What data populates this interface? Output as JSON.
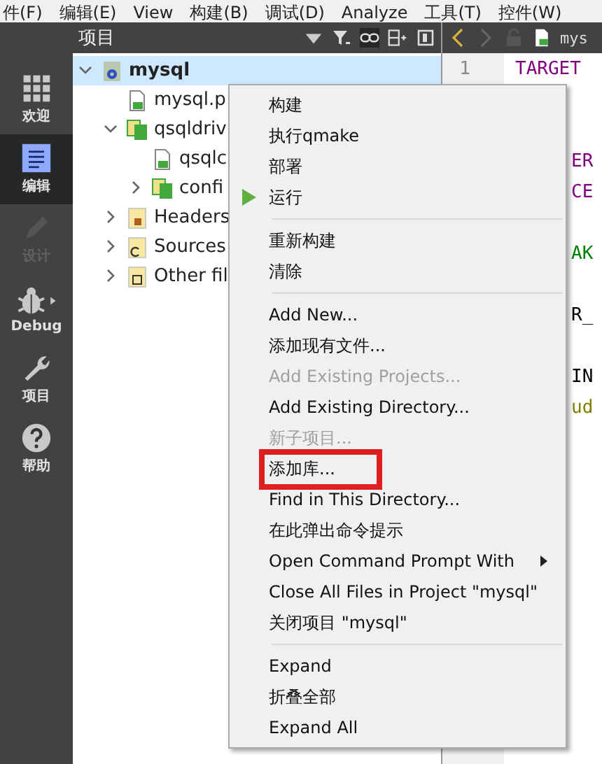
{
  "menu_bar": [
    "件(F)",
    "编辑(E)",
    "View",
    "构建(B)",
    "调试(D)",
    "Analyze",
    "工具(T)",
    "控件(W)"
  ],
  "mode_bar": [
    {
      "label": "欢迎",
      "kind": "welcome",
      "selected": false,
      "disabled": false
    },
    {
      "label": "编辑",
      "kind": "edit",
      "selected": true,
      "disabled": false
    },
    {
      "label": "设计",
      "kind": "design",
      "selected": false,
      "disabled": true
    },
    {
      "label": "Debug",
      "kind": "debug",
      "selected": false,
      "disabled": false
    },
    {
      "label": "项目",
      "kind": "projects",
      "selected": false,
      "disabled": false
    },
    {
      "label": "帮助",
      "kind": "help",
      "selected": false,
      "disabled": false
    }
  ],
  "project_panel": {
    "title": "项目",
    "tree": [
      {
        "label": "mysql",
        "kind": "project",
        "expanded": true,
        "selected": true,
        "children": [
          {
            "label": "mysql.p",
            "kind": "profile",
            "selected": false
          },
          {
            "label": "qsqldriv",
            "kind": "folder",
            "expanded": true,
            "selected": false,
            "children": [
              {
                "label": "qsqlc",
                "kind": "profile",
                "selected": false
              },
              {
                "label": "confi",
                "kind": "folder",
                "expanded": false,
                "selected": false
              }
            ]
          },
          {
            "label": "Headers",
            "kind": "headers",
            "expanded": false,
            "selected": false
          },
          {
            "label": "Sources",
            "kind": "sources",
            "expanded": false,
            "selected": false
          },
          {
            "label": "Other fil",
            "kind": "other",
            "expanded": false,
            "selected": false
          }
        ]
      }
    ]
  },
  "editor": {
    "tab_title": "mys",
    "line_number": "1",
    "first_line": "TARGET",
    "fragments": [
      {
        "kind": "blank"
      },
      {
        "kind": "blank"
      },
      {
        "kind": "text",
        "text": "ER",
        "color": "#800080"
      },
      {
        "kind": "text",
        "text": "CE",
        "color": "#800080"
      },
      {
        "kind": "blank"
      },
      {
        "kind": "text",
        "text": "AK",
        "color": "#008000"
      },
      {
        "kind": "blank"
      },
      {
        "kind": "text",
        "text": "R_",
        "color": "#000000"
      },
      {
        "kind": "blank"
      },
      {
        "kind": "text",
        "text": "IN",
        "color": "#000000"
      },
      {
        "kind": "text",
        "text": "ud",
        "color": "#808000"
      }
    ]
  },
  "context_menu": {
    "items": [
      {
        "kind": "item",
        "label": "构建",
        "disabled": false
      },
      {
        "kind": "item",
        "label": "执行qmake",
        "disabled": false
      },
      {
        "kind": "item",
        "label": "部署",
        "disabled": false
      },
      {
        "kind": "run",
        "label": "运行",
        "disabled": false
      },
      {
        "kind": "separator"
      },
      {
        "kind": "item",
        "label": "重新构建",
        "disabled": false
      },
      {
        "kind": "item",
        "label": "清除",
        "disabled": false
      },
      {
        "kind": "separator"
      },
      {
        "kind": "item",
        "label": "Add New...",
        "disabled": false
      },
      {
        "kind": "item",
        "label": "添加现有文件...",
        "disabled": false
      },
      {
        "kind": "item",
        "label": "Add Existing Projects...",
        "disabled": true
      },
      {
        "kind": "item",
        "label": "Add Existing Directory...",
        "disabled": false
      },
      {
        "kind": "item",
        "label": "新子项目...",
        "disabled": true
      },
      {
        "kind": "item",
        "label": "添加库...",
        "disabled": false,
        "highlighted": true
      },
      {
        "kind": "item",
        "label": "Find in This Directory...",
        "disabled": false
      },
      {
        "kind": "item",
        "label": "在此弹出命令提示",
        "disabled": false
      },
      {
        "kind": "submenu",
        "label": "Open Command Prompt With",
        "disabled": false
      },
      {
        "kind": "item",
        "label": "Close All Files in Project \"mysql\"",
        "disabled": false
      },
      {
        "kind": "item",
        "label": "关闭项目 \"mysql\"",
        "disabled": false
      },
      {
        "kind": "separator"
      },
      {
        "kind": "item",
        "label": "Expand",
        "disabled": false
      },
      {
        "kind": "item",
        "label": "折叠全部",
        "disabled": false
      },
      {
        "kind": "item",
        "label": "Expand All",
        "disabled": false
      }
    ]
  }
}
